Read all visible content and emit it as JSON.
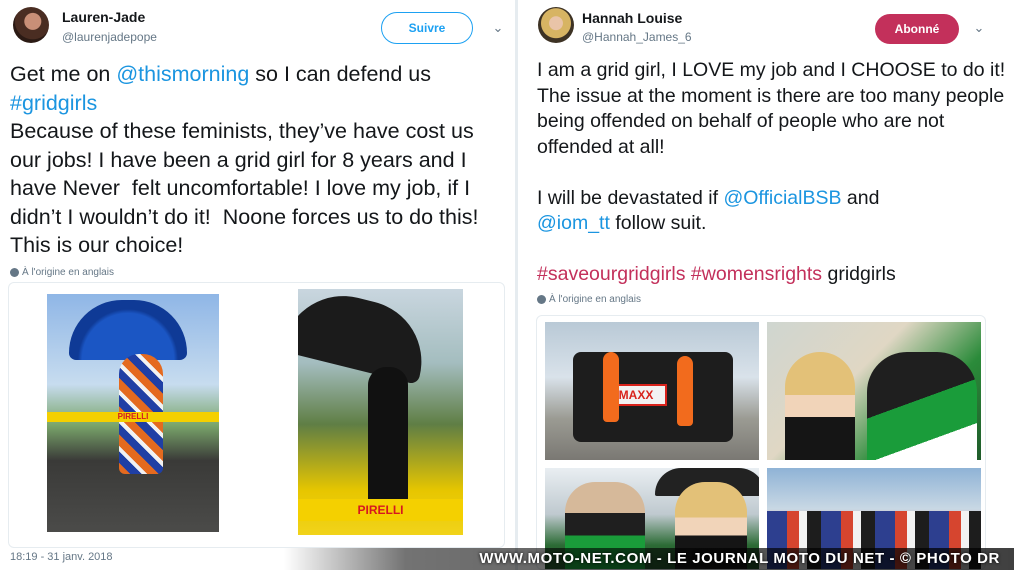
{
  "left_tweet": {
    "name": "Lauren-Jade",
    "handle": "@laurenjadepope",
    "follow_label": "Suivre",
    "text_parts": [
      "Get me on ",
      "@thismorning",
      " so I can defend us\n",
      "#gridgirls",
      "\nBecause of these feminists, they’ve have cost us our jobs! I have been a grid girl for 8 years and I have Never  felt uncomfortable! I love my job, if I didn’t I wouldn’t do it!  Noone forces us to do this! This is our choice!"
    ],
    "translate_label": "À l'origine en anglais",
    "date": "18:19 - 31 janv. 2018",
    "photo_1_brand_text": "PIRELLI",
    "photo_2_brand_text": "PIRELLI"
  },
  "right_tweet": {
    "name": "Hannah Louise",
    "handle": "@Hannah_James_6",
    "follow_label": "Abonné",
    "text_parts": [
      "I am a grid girl, I LOVE my job and I CHOOSE to do it! The issue at the moment is there are too many people being offended on behalf of people who are not offended at all!\n\nI will be devastated if ",
      "@OfficialBSB",
      " and\n",
      "@iom_tt",
      " follow suit.\n\n",
      "#saveourgridgirls",
      " ",
      "#womensrights",
      " gridgirls"
    ],
    "translate_label": "À l'origine en anglais",
    "truck_sign_text": "MAXX"
  },
  "watermark": "WWW.MOTO-NET.COM - LE JOURNAL MOTO DU NET - © PHOTO DR",
  "colors": {
    "link_blue": "#1b95e0",
    "follow_blue": "#1da1f2",
    "accent_red": "#c3305b",
    "muted": "#657786"
  }
}
